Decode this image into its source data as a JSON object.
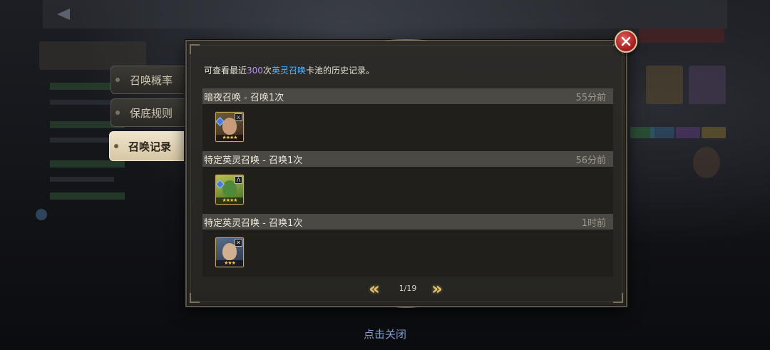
{
  "tabs": [
    {
      "label": "召唤概率",
      "active": false
    },
    {
      "label": "保底规则",
      "active": false
    },
    {
      "label": "召唤记录",
      "active": true
    }
  ],
  "intro": {
    "prefix": "可查看最近",
    "count": "300",
    "middle": "次",
    "pool": "英灵召唤",
    "suffix": "卡池的历史记录。"
  },
  "records": [
    {
      "title": "暗夜召唤 - 召唤1次",
      "time": "55分前",
      "stars": "★★★★",
      "hero_icon": "hero-portrait-icon"
    },
    {
      "title": "特定英灵召唤 - 召唤1次",
      "time": "56分前",
      "stars": "★★★★",
      "hero_icon": "hero-portrait-icon"
    },
    {
      "title": "特定英灵召唤 - 召唤1次",
      "time": "1时前",
      "stars": "★★★",
      "hero_icon": "hero-portrait-icon"
    }
  ],
  "pager": {
    "prev_icon": "double-chevron-left-icon",
    "next_icon": "double-chevron-right-icon",
    "label": "1/19"
  },
  "close_icon": "close-icon",
  "tap_to_close": "点击关闭",
  "colors": {
    "highlight_count": "#b98cff",
    "highlight_pool": "#4fb4ff",
    "close_button": "#b12424",
    "pager_arrows": "#e2c26b"
  }
}
